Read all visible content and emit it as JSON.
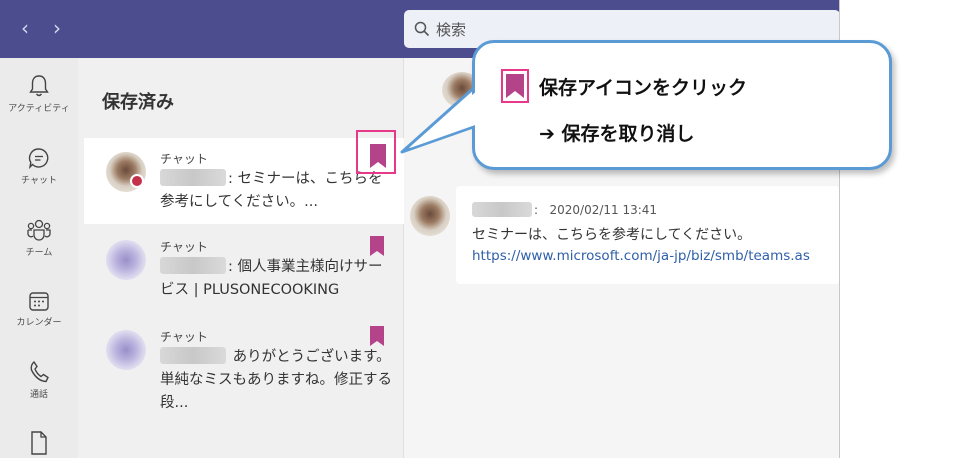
{
  "titlebar": {
    "back_glyph": "‹",
    "forward_glyph": "›",
    "search_placeholder": "検索"
  },
  "rail": {
    "items": [
      {
        "label": "アクティビティ",
        "icon": "bell-icon"
      },
      {
        "label": "チャット",
        "icon": "chat-icon"
      },
      {
        "label": "チーム",
        "icon": "teams-icon"
      },
      {
        "label": "カレンダー",
        "icon": "calendar-icon"
      },
      {
        "label": "通話",
        "icon": "phone-icon"
      },
      {
        "label": "",
        "icon": "file-icon"
      }
    ]
  },
  "saved": {
    "title": "保存済み",
    "items": [
      {
        "type": "チャット",
        "text": ": セミナーは、こちらを参考にしてください。..."
      },
      {
        "type": "チャット",
        "text": ": 個人事業主様向けサービス | PLUSONECOOKING"
      },
      {
        "type": "チャット",
        "text": " ありがとうございます。単純なミスもありますね。修正する段..."
      }
    ]
  },
  "message": {
    "sender_suffix": ":",
    "timestamp": "2020/02/11 13:41",
    "body": "セミナーは、こちらを参考にしてください。",
    "link": "https://www.microsoft.com/ja-jp/biz/smb/teams.as"
  },
  "callout": {
    "line1": "保存アイコンをクリック",
    "line2": "➔ 保存を取り消し"
  },
  "colors": {
    "titlebar": "#4b4d8f",
    "bookmark": "#b4438a",
    "highlight": "#e8388a",
    "callout_border": "#5b9bd5"
  }
}
